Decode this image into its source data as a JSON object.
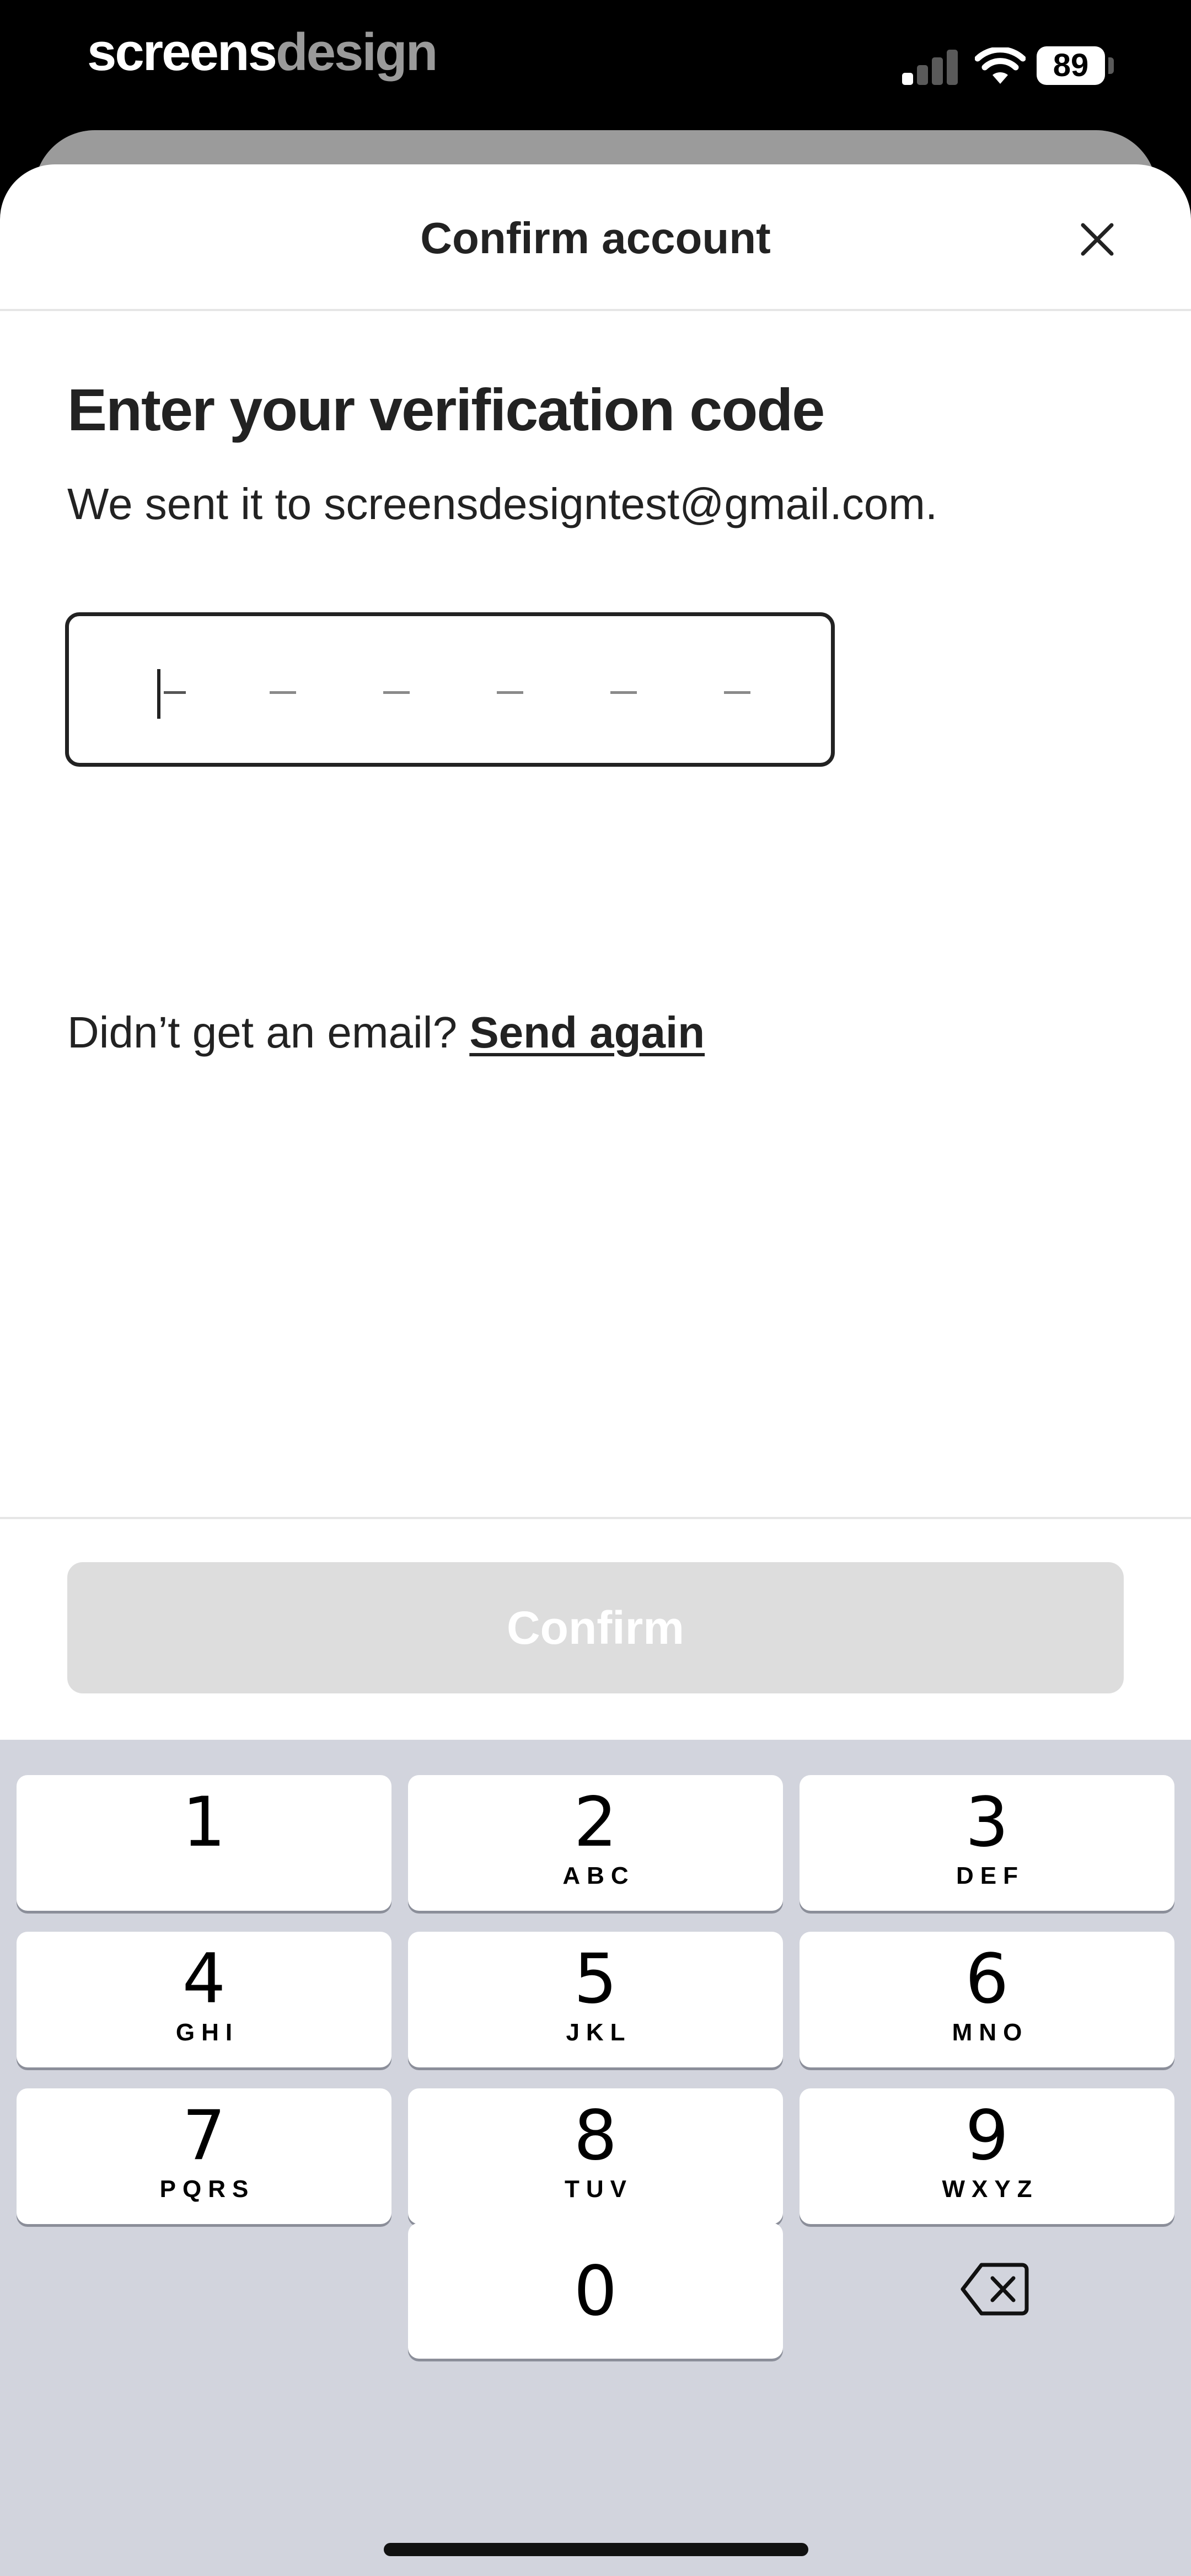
{
  "status_bar": {
    "brand_part1": "screens",
    "brand_part2": "design",
    "battery_level": "89",
    "signal_bars_active": 1,
    "signal_bars_total": 4
  },
  "sheet": {
    "title": "Confirm account",
    "heading": "Enter your verification code",
    "subtext": "We sent it to screensdesigntest@gmail.com.",
    "code": {
      "length": 6,
      "value": "",
      "slot_glyph": "–"
    },
    "resend_prompt": "Didn’t get an email?",
    "resend_link": "Send again",
    "confirm_label": "Confirm",
    "confirm_enabled": false
  },
  "keypad": {
    "keys": [
      {
        "digit": "1",
        "letters": ""
      },
      {
        "digit": "2",
        "letters": "ABC"
      },
      {
        "digit": "3",
        "letters": "DEF"
      },
      {
        "digit": "4",
        "letters": "GHI"
      },
      {
        "digit": "5",
        "letters": "JKL"
      },
      {
        "digit": "6",
        "letters": "MNO"
      },
      {
        "digit": "7",
        "letters": "PQRS"
      },
      {
        "digit": "8",
        "letters": "TUV"
      },
      {
        "digit": "9",
        "letters": "WXYZ"
      },
      {
        "digit": "0",
        "letters": ""
      }
    ]
  },
  "icons": {
    "close": "close-icon",
    "backspace": "backspace-icon",
    "wifi": "wifi-icon",
    "signal": "signal-icon",
    "battery": "battery-icon"
  },
  "colors": {
    "text": "#222222",
    "disabled_button": "#dddddd",
    "keypad_bg": "#d2d4dd",
    "divider": "#e6e6e6"
  }
}
